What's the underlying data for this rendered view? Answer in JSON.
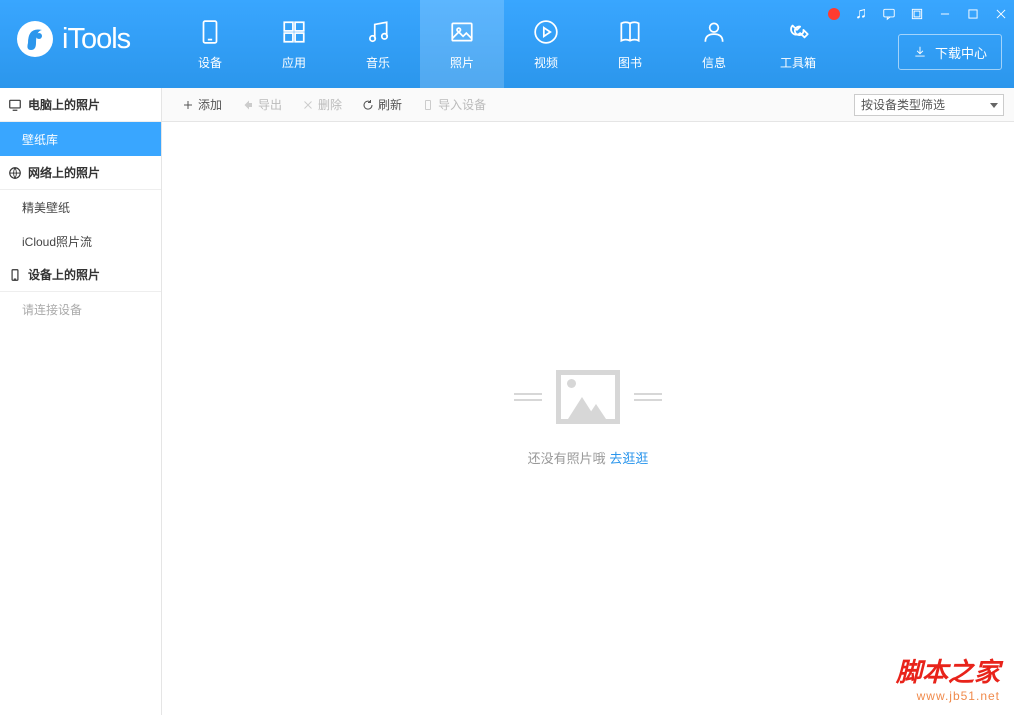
{
  "app": {
    "title": "iTools"
  },
  "nav": {
    "items": [
      {
        "label": "设备"
      },
      {
        "label": "应用"
      },
      {
        "label": "音乐"
      },
      {
        "label": "照片"
      },
      {
        "label": "视频"
      },
      {
        "label": "图书"
      },
      {
        "label": "信息"
      },
      {
        "label": "工具箱"
      }
    ],
    "active_index": 3,
    "download_center": "下载中心"
  },
  "toolbar": {
    "add": "添加",
    "export": "导出",
    "delete": "删除",
    "refresh": "刷新",
    "import_device": "导入设备",
    "filter": "按设备类型筛选"
  },
  "sidebar": {
    "sections": [
      {
        "title": "电脑上的照片",
        "items": [
          {
            "label": "壁纸库",
            "active": true
          }
        ]
      },
      {
        "title": "网络上的照片",
        "items": [
          {
            "label": "精美壁纸"
          },
          {
            "label": "iCloud照片流"
          }
        ]
      },
      {
        "title": "设备上的照片",
        "items": [
          {
            "label": "请连接设备",
            "hint": true
          }
        ]
      }
    ]
  },
  "empty": {
    "text": "还没有照片哦",
    "link": "去逛逛"
  },
  "watermark": {
    "title": "脚本之家",
    "url": "www.jb51.net"
  }
}
